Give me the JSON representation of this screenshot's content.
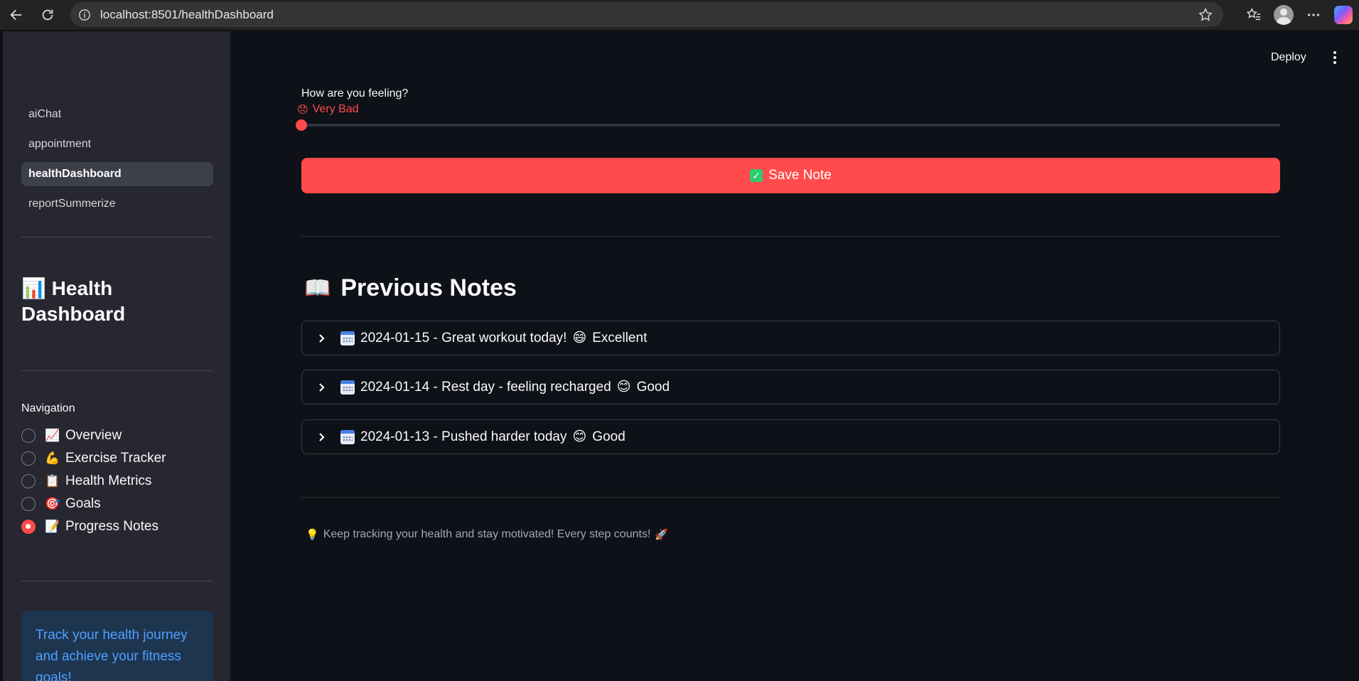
{
  "browser": {
    "url": "localhost:8501/healthDashboard"
  },
  "sidebar": {
    "pages": [
      {
        "label": "aiChat",
        "active": false
      },
      {
        "label": "appointment",
        "active": false
      },
      {
        "label": "healthDashboard",
        "active": true
      },
      {
        "label": "reportSummerize",
        "active": false
      }
    ],
    "title_icon": "📊",
    "title": "Health Dashboard",
    "navigation_label": "Navigation",
    "navigation_items": [
      {
        "icon": "📈",
        "label": "Overview",
        "selected": false
      },
      {
        "icon": "💪",
        "label": "Exercise Tracker",
        "selected": false
      },
      {
        "icon": "📋",
        "label": "Health Metrics",
        "selected": false
      },
      {
        "icon": "🎯",
        "label": "Goals",
        "selected": false
      },
      {
        "icon": "📝",
        "label": "Progress Notes",
        "selected": true
      }
    ],
    "info_text": "Track your health journey and achieve your fitness goals!"
  },
  "header": {
    "deploy_label": "Deploy"
  },
  "main": {
    "slider": {
      "label": "How are you feeling?",
      "value_emoji": "😞",
      "value_label": "Very Bad",
      "position": 0
    },
    "save_button": {
      "icon": "✅",
      "label": "Save Note"
    },
    "previous_notes": {
      "icon": "📖",
      "title": "Previous Notes",
      "notes": [
        {
          "text": "2024-01-15 - Great workout today!",
          "emoji": "😄",
          "mood": "Excellent"
        },
        {
          "text": "2024-01-14 - Rest day - feeling recharged",
          "emoji": "😊",
          "mood": "Good"
        },
        {
          "text": "2024-01-13 - Pushed harder today",
          "emoji": "😊",
          "mood": "Good"
        }
      ]
    },
    "footer_tip": {
      "icon_start": "💡",
      "text": "Keep tracking your health and stay motivated! Every step counts!",
      "icon_end": "🚀"
    }
  },
  "colors": {
    "accent": "#ff4b4b",
    "sidebar_bg": "#262730",
    "main_bg": "#0e1117",
    "info_bg": "#1e3550",
    "info_text": "#4ca0ff"
  }
}
